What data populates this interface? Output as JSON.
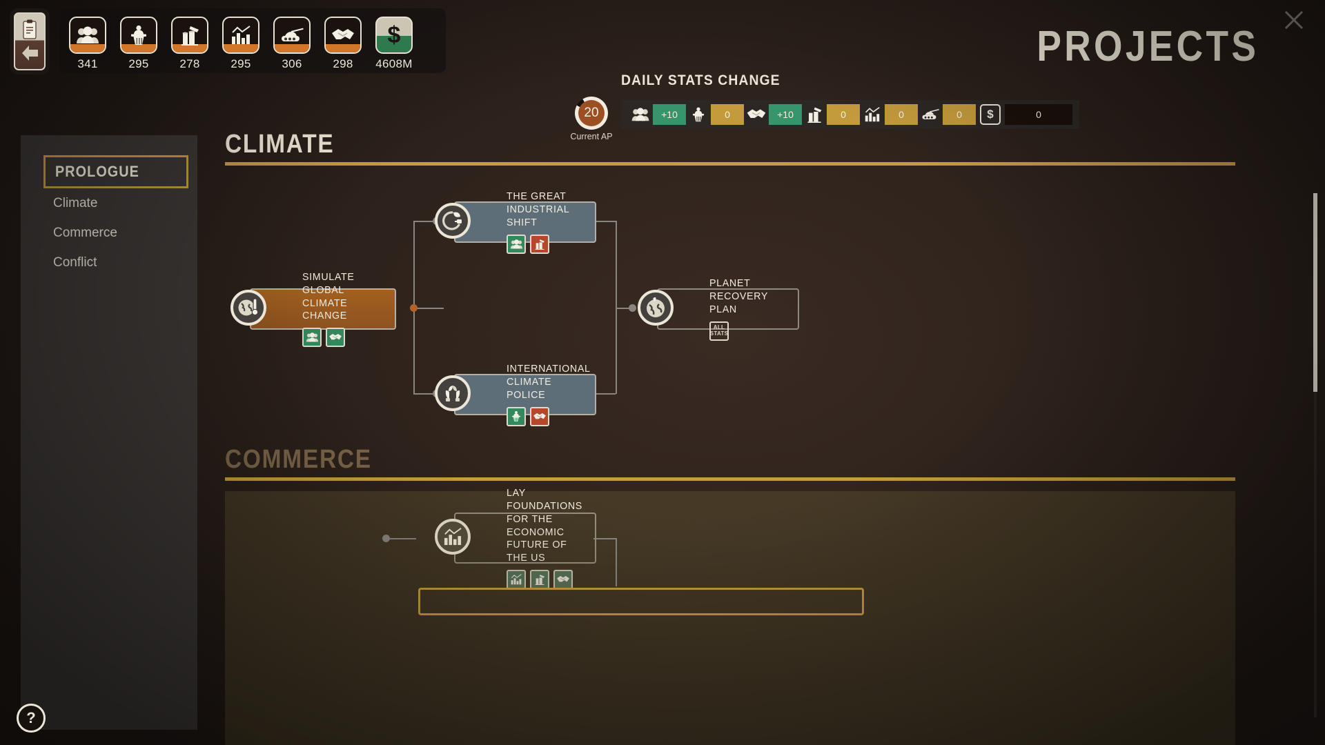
{
  "window": {
    "title": "PROJECTS",
    "close_label": "✕"
  },
  "hud": {
    "back_button_name": "back",
    "stats": [
      {
        "icon": "population-icon",
        "value": "341"
      },
      {
        "icon": "politics-icon",
        "value": "295"
      },
      {
        "icon": "industry-icon",
        "value": "278"
      },
      {
        "icon": "economy-icon",
        "value": "295"
      },
      {
        "icon": "military-icon",
        "value": "306"
      },
      {
        "icon": "diplomacy-icon",
        "value": "298"
      },
      {
        "icon": "money-icon",
        "value": "4608M"
      }
    ]
  },
  "daily_stats": {
    "label": "DAILY STATS CHANGE",
    "current_ap": {
      "value": "20",
      "caption": "Current AP"
    },
    "entries": [
      {
        "icon": "population-icon",
        "value": "+10",
        "tone": "pos"
      },
      {
        "icon": "politics-icon",
        "value": "0",
        "tone": "zero"
      },
      {
        "icon": "diplomacy-icon",
        "value": "+10",
        "tone": "pos"
      },
      {
        "icon": "industry-icon",
        "value": "0",
        "tone": "zero"
      },
      {
        "icon": "economy-icon",
        "value": "0",
        "tone": "zero"
      },
      {
        "icon": "military-icon",
        "value": "0",
        "tone": "zero"
      }
    ],
    "money": {
      "symbol": "$",
      "value": "0"
    }
  },
  "sidebar": {
    "header": "PROLOGUE",
    "items": [
      {
        "label": "Climate"
      },
      {
        "label": "Commerce"
      },
      {
        "label": "Conflict"
      }
    ],
    "help_label": "?"
  },
  "sections": [
    {
      "title": "CLIMATE",
      "state": "active"
    },
    {
      "title": "COMMERCE",
      "state": "dim"
    }
  ],
  "projects": {
    "simulate_global_climate_change": {
      "title": "SIMULATE GLOBAL CLIMATE CHANGE",
      "badge_icon": "globe-thermometer-icon",
      "state": "done",
      "chips": [
        {
          "icon": "population-icon",
          "tone": "green"
        },
        {
          "icon": "diplomacy-icon",
          "tone": "green"
        }
      ]
    },
    "the_great_industrial_shift": {
      "title": "THE GREAT INDUSTRIAL SHIFT",
      "badge_icon": "plug-leaf-icon",
      "state": "avail",
      "chips": [
        {
          "icon": "population-icon",
          "tone": "green"
        },
        {
          "icon": "industry-icon",
          "tone": "red"
        }
      ]
    },
    "international_climate_police": {
      "title": "INTERNATIONAL CLIMATE POLICE",
      "badge_icon": "hands-plant-icon",
      "state": "avail",
      "chips": [
        {
          "icon": "politics-icon",
          "tone": "green"
        },
        {
          "icon": "diplomacy-icon",
          "tone": "red"
        }
      ]
    },
    "planet_recovery_plan": {
      "title": "PLANET RECOVERY PLAN",
      "badge_icon": "globe-leaf-icon",
      "state": "locked",
      "chips": [
        {
          "icon": "all-stats-icon",
          "tone": "none",
          "text": "ALL\nSTATS"
        }
      ]
    },
    "lay_foundations_economic": {
      "title": "LAY FOUNDATIONS FOR THE ECONOMIC\nFUTURE OF THE US",
      "badge_icon": "economy-icon",
      "state": "tinted",
      "chips": [
        {
          "icon": "economy-icon",
          "tone": "muted"
        },
        {
          "icon": "industry-icon",
          "tone": "muted"
        },
        {
          "icon": "diplomacy-icon",
          "tone": "muted"
        }
      ]
    }
  },
  "colors": {
    "accent_gold": "#c79b3f",
    "positive_green": "#36956a",
    "neutral_gold": "#c39a3c",
    "negative_red": "#b5472a",
    "card_done": "#a3601f",
    "card_available": "#5d6e78",
    "cream": "#f0ead9"
  }
}
